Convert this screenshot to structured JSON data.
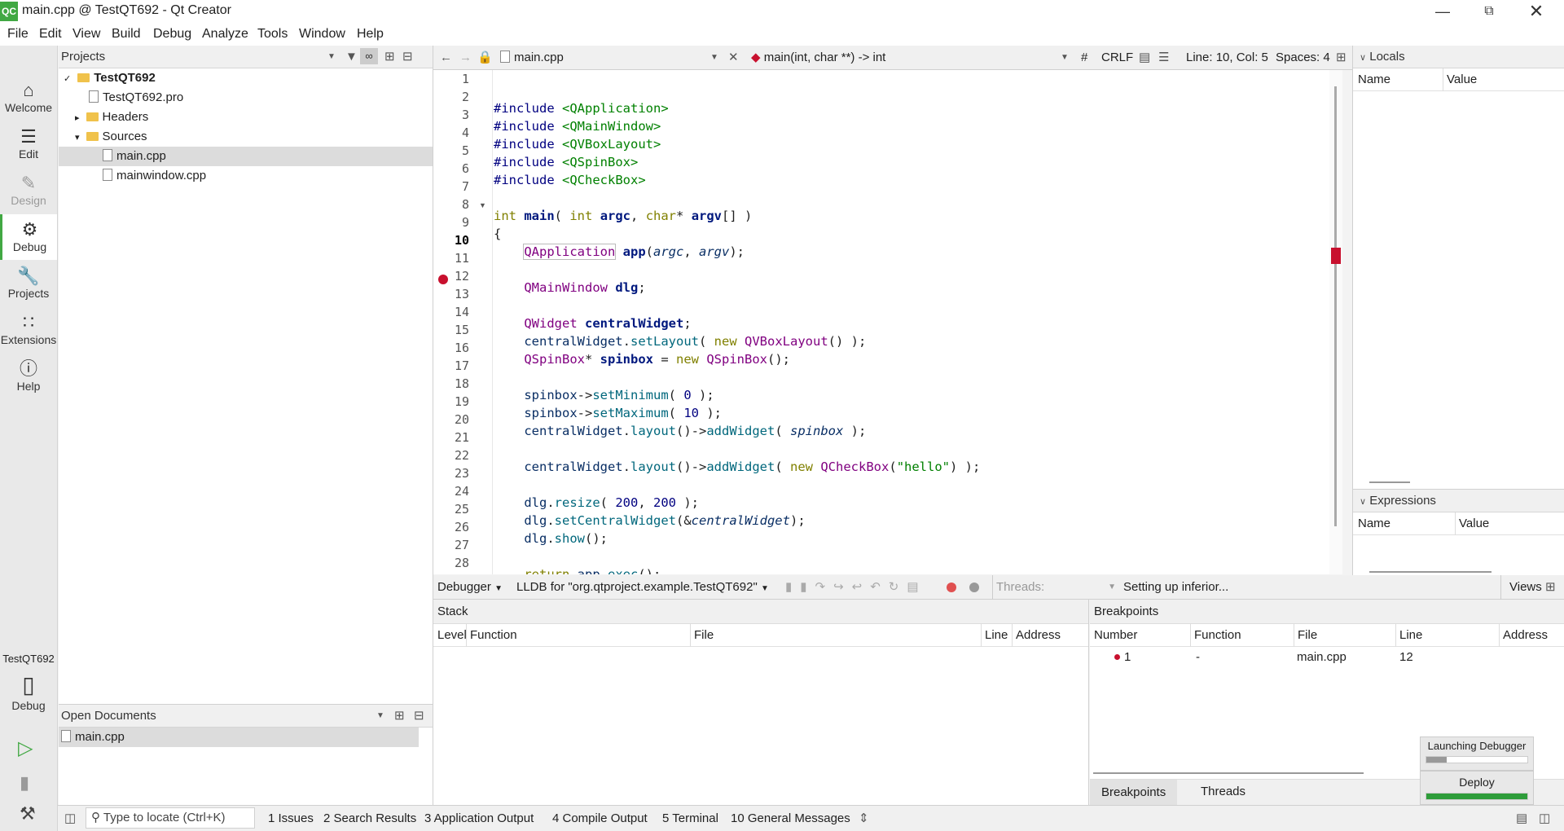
{
  "window": {
    "title": "main.cpp @ TestQT692 - Qt Creator",
    "logo": "QC"
  },
  "menu": [
    "File",
    "Edit",
    "View",
    "Build",
    "Debug",
    "Analyze",
    "Tools",
    "Window",
    "Help"
  ],
  "modes": [
    {
      "label": "Welcome",
      "icon": "home-icon"
    },
    {
      "label": "Edit",
      "icon": "edit-icon"
    },
    {
      "label": "Design",
      "icon": "design-icon"
    },
    {
      "label": "Debug",
      "icon": "bug-icon"
    },
    {
      "label": "Projects",
      "icon": "wrench-icon"
    },
    {
      "label": "Extensions",
      "icon": "extensions-icon"
    },
    {
      "label": "Help",
      "icon": "help-icon"
    }
  ],
  "kit": {
    "project": "TestQT692",
    "label": "Debug"
  },
  "projects_panel": {
    "title": "Projects",
    "tree": [
      {
        "label": "TestQT692"
      },
      {
        "label": "TestQT692.pro"
      },
      {
        "label": "Headers"
      },
      {
        "label": "Sources"
      },
      {
        "label": "main.cpp"
      },
      {
        "label": "mainwindow.cpp"
      }
    ]
  },
  "open_docs": {
    "title": "Open Documents",
    "items": [
      "main.cpp"
    ]
  },
  "editor_toolbar": {
    "file": "main.cpp",
    "symbol": "main(int, char **) -> int",
    "hash": "#",
    "eol": "CRLF",
    "position": "Line: 10, Col: 5",
    "spaces": "Spaces: 4"
  },
  "code": {
    "current_line": 10,
    "breakpoint_line": 12,
    "lines": [
      "1",
      "2",
      "3",
      "4",
      "5",
      "6",
      "7",
      "8",
      "9",
      "10",
      "11",
      "12",
      "13",
      "14",
      "15",
      "16",
      "17",
      "18",
      "19",
      "20",
      "21",
      "22",
      "23",
      "24",
      "25",
      "26",
      "27",
      "28"
    ]
  },
  "locals": {
    "title": "Locals",
    "col_name": "Name",
    "col_value": "Value"
  },
  "expressions": {
    "title": "Expressions",
    "col_name": "Name",
    "col_value": "Value"
  },
  "debug_toolbar": {
    "debugger": "Debugger",
    "engine": "LLDB for \"org.qtproject.example.TestQT692\"",
    "threads": "Threads:",
    "status": "Setting up inferior...",
    "views": "Views"
  },
  "stack": {
    "title": "Stack",
    "columns": [
      "Level",
      "Function",
      "File",
      "Line",
      "Address"
    ]
  },
  "breakpoints": {
    "title": "Breakpoints",
    "columns": [
      "Number",
      "Function",
      "File",
      "Line",
      "Address"
    ],
    "rows": [
      {
        "number": "1",
        "function": "-",
        "file": "main.cpp",
        "line": "12",
        "address": ""
      }
    ],
    "tabs": [
      "Breakpoints",
      "Threads"
    ]
  },
  "progress": {
    "launching": "Launching Debugger",
    "launching_fraction": 0.2,
    "deploy": "Deploy",
    "deploy_fraction": 1.0
  },
  "statusbar": {
    "locate_placeholder": "Type to locate (Ctrl+K)",
    "tabs": [
      "1  Issues",
      "2  Search Results",
      "3  Application Output",
      "4  Compile Output",
      "5  Terminal",
      "10  General Messages"
    ]
  },
  "colors": {
    "accent": "#41a843",
    "breakpoint": "#c8102e"
  }
}
